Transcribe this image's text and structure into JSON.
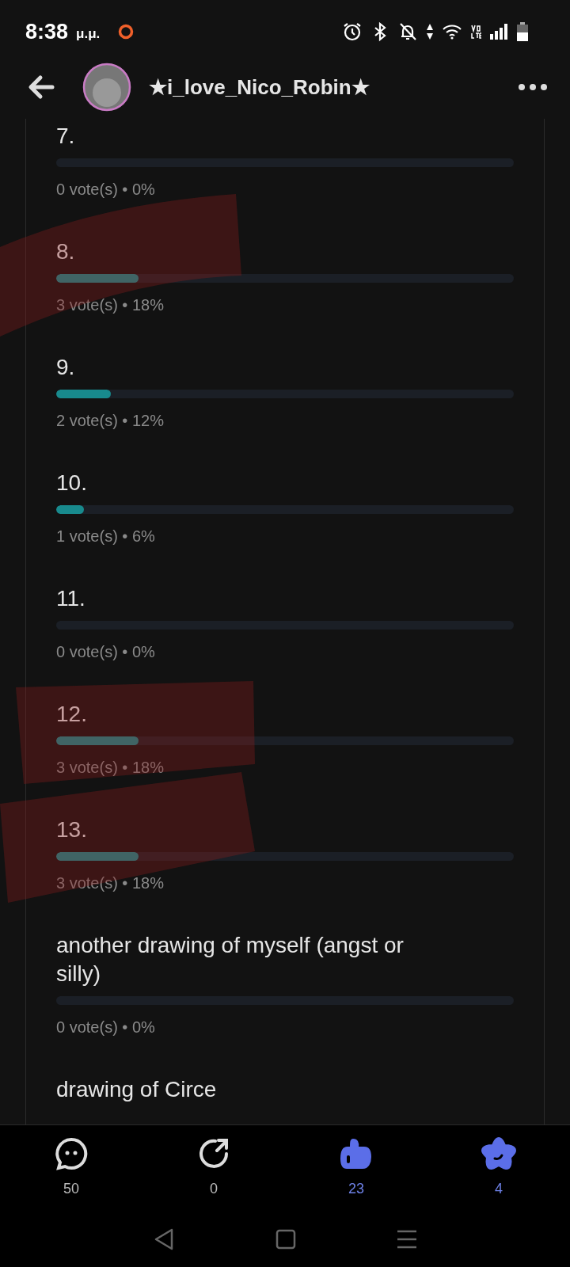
{
  "status_bar": {
    "time": "8:38",
    "meridiem": "μ.μ."
  },
  "header": {
    "title": "★i_love_Nico_Robin★"
  },
  "poll_options": [
    {
      "label": "7.",
      "votes": "0 vote(s) • 0%"
    },
    {
      "label": "8.",
      "level": 0.18,
      "votes": "3 vote(s) • 18%"
    },
    {
      "label": "9.",
      "level": 0.12,
      "votes": "2 vote(s) • 12%"
    },
    {
      "label": "10.",
      "level": 0.06,
      "votes": "1 vote(s) • 6%"
    },
    {
      "label": "11.",
      "votes": "0 vote(s) • 0%"
    },
    {
      "label": "12.",
      "level": 0.18,
      "votes": "3 vote(s) • 18%"
    },
    {
      "label": "13.",
      "level": 0.18,
      "votes": "3 vote(s) • 18%"
    },
    {
      "label": "another drawing of myself (angst or silly)",
      "votes": "0 vote(s) • 0%"
    },
    {
      "label": "drawing of Circe"
    }
  ],
  "actions": [
    {
      "kind": "comment",
      "count": "50",
      "active": false
    },
    {
      "kind": "share",
      "count": "0",
      "active": false
    },
    {
      "kind": "like",
      "count": "23",
      "active": true
    },
    {
      "kind": "star",
      "count": "4",
      "active": true
    }
  ]
}
